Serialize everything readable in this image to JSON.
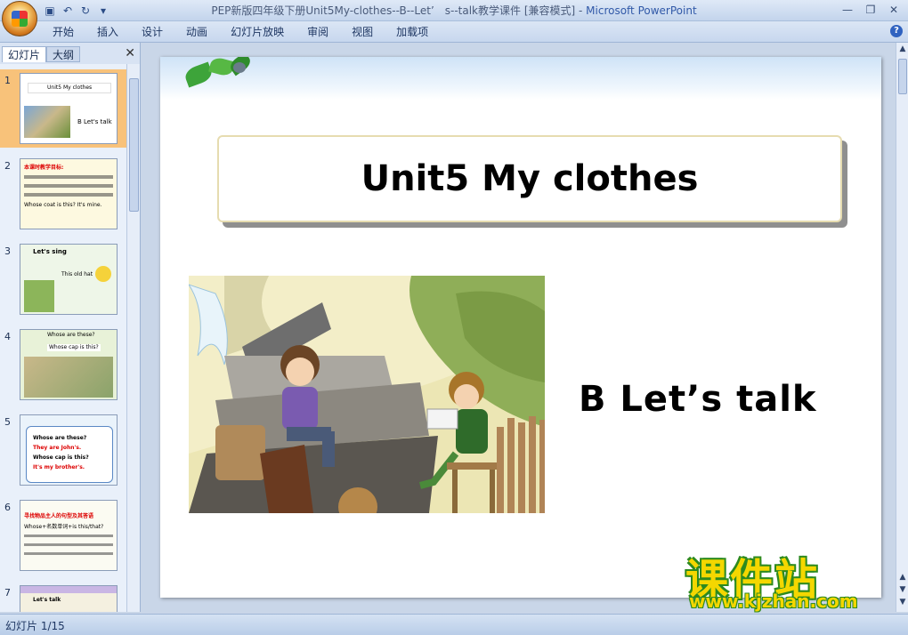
{
  "window": {
    "title_doc": "PEP新版四年级下册Unit5My-clothes--B--Let’　s--talk教学课件 [兼容模式] - ",
    "title_app": "Microsoft PowerPoint"
  },
  "ribbon": {
    "tabs": [
      "开始",
      "插入",
      "设计",
      "动画",
      "幻灯片放映",
      "审阅",
      "视图",
      "加载项"
    ]
  },
  "panel": {
    "tab_slides": "幻灯片",
    "tab_outline": "大纲",
    "thumbnails": [
      {
        "num": "1",
        "line1": "Unit5 My clothes",
        "line2": "B Let's talk"
      },
      {
        "num": "2",
        "line1": "本课时教学目标:",
        "line2": "Whose coat is this? It's mine."
      },
      {
        "num": "3",
        "line1": "Let's sing",
        "line2": "This old hat"
      },
      {
        "num": "4",
        "line1": "Whose are these?",
        "line2": "Whose cap is this?"
      },
      {
        "num": "5",
        "line1": "Whose are these?",
        "line2": "They are John's.",
        "line3": "Whose cap is this?",
        "line4": "It's my brother's."
      },
      {
        "num": "6",
        "line1": "寻找物品主人的句型及其答语",
        "line2": "Whose+名数单词+is this/that?"
      },
      {
        "num": "7",
        "line1": "Let's talk",
        "line2": ""
      }
    ]
  },
  "slide": {
    "title": "Unit5 My clothes",
    "subtitle": "B Let’s talk"
  },
  "status": {
    "slide_info": "幻灯片 1/15"
  },
  "watermark": {
    "cn": "课件站",
    "url": "www.kjzhan.com"
  }
}
